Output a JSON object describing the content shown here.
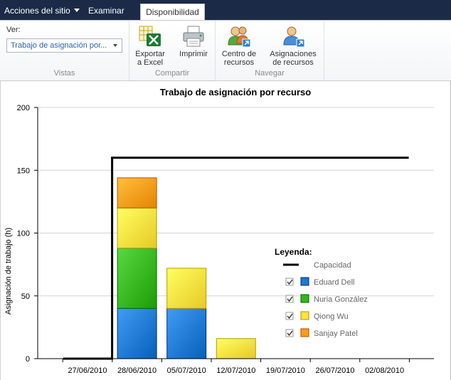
{
  "topbar": {
    "site_actions": "Acciones del sitio",
    "browse": "Examinar",
    "active_tab": "Disponibilidad"
  },
  "ribbon": {
    "views": {
      "ver_label": "Ver:",
      "selected_view": "Trabajo de asignación por...",
      "group_label": "Vistas"
    },
    "share": {
      "export_line1": "Exportar",
      "export_line2": "a Excel",
      "print": "Imprimir",
      "group_label": "Compartir"
    },
    "navigate": {
      "resource_center_line1": "Centro de",
      "resource_center_line2": "recursos",
      "assignments_line1": "Asignaciones",
      "assignments_line2": "de recursos",
      "group_label": "Navegar"
    }
  },
  "chart_data": {
    "type": "bar",
    "title": "Trabajo de asignación por recurso",
    "ylabel": "Asignación de trabajo (h)",
    "xlabel": "",
    "ylim": [
      0,
      200
    ],
    "yticks": [
      0,
      50,
      100,
      150,
      200
    ],
    "categories": [
      "27/06/2010",
      "28/06/2010",
      "05/07/2010",
      "12/07/2010",
      "19/07/2010",
      "26/07/2010",
      "02/08/2010"
    ],
    "series": [
      {
        "name": "Eduard Dell",
        "color": "#1f78d1",
        "values": [
          0,
          40,
          40,
          0,
          0,
          0,
          0
        ]
      },
      {
        "name": "Nuria González",
        "color": "#36b51f",
        "values": [
          0,
          48,
          0,
          0,
          0,
          0,
          0
        ]
      },
      {
        "name": "Qiong Wu",
        "color": "#ffe23e",
        "values": [
          0,
          32,
          32,
          16,
          0,
          0,
          0
        ]
      },
      {
        "name": "Sanjay Patel",
        "color": "#ff9c1a",
        "values": [
          0,
          24,
          0,
          0,
          0,
          0,
          0
        ]
      }
    ],
    "capacity": {
      "name": "Capacidad",
      "color": "#000000",
      "values": [
        0,
        160,
        160,
        160,
        160,
        160,
        160
      ]
    },
    "legend": {
      "title": "Leyenda:",
      "position": "lower-right"
    },
    "grid": true
  }
}
